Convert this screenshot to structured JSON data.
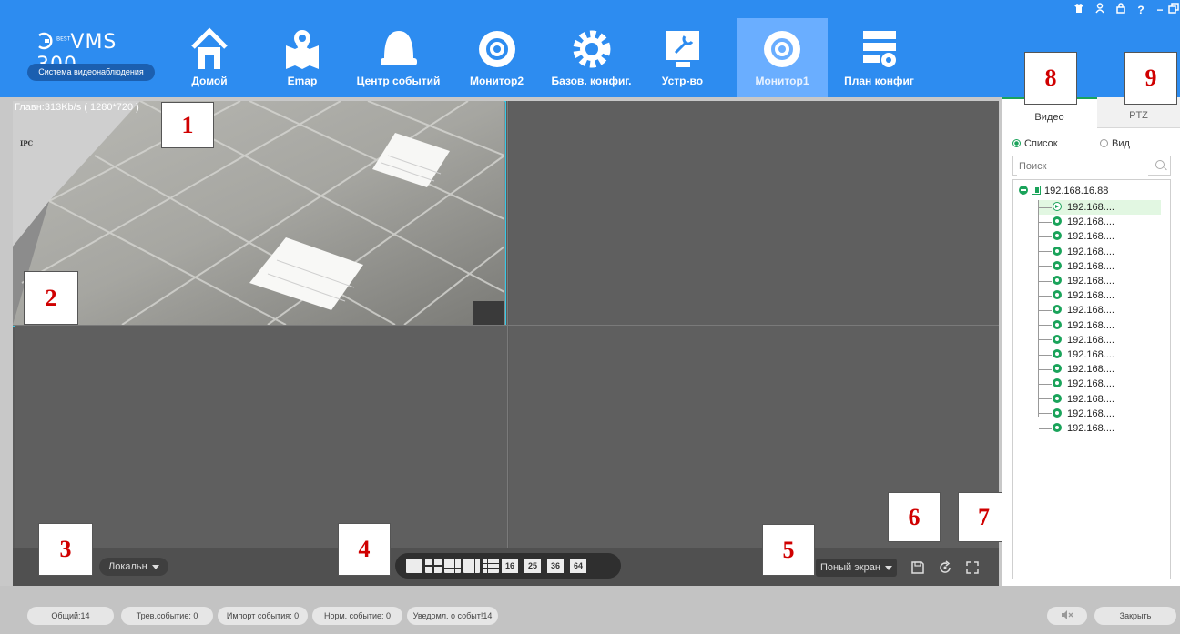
{
  "app": {
    "brand_prefix": "BEST",
    "brand_name": "VMS 300",
    "tagline": "Система видеонаблюдения"
  },
  "nav": [
    {
      "label": "Домой",
      "icon": "home-icon"
    },
    {
      "label": "Emap",
      "icon": "map-pin-icon"
    },
    {
      "label": "Центр событий",
      "icon": "alarm-bell-icon"
    },
    {
      "label": "Монитор2",
      "icon": "monitor-camera-icon"
    },
    {
      "label": "Базов. конфиг.",
      "icon": "gear-icon"
    },
    {
      "label": "Устр-во",
      "icon": "wrench-icon"
    },
    {
      "label": "Монитор1",
      "icon": "monitor-camera-icon",
      "active": true
    },
    {
      "label": "План конфиг",
      "icon": "schedule-config-icon"
    }
  ],
  "window_controls": [
    "shirt-icon",
    "user-icon",
    "lock-icon",
    "?",
    "−",
    "restore-icon",
    "×"
  ],
  "video": {
    "stream_info": "Главн:313Kb/s ( 1280*720 )",
    "camera_overlay": "IPC",
    "source_select": "Локальн",
    "layouts": [
      "1",
      "4",
      "6",
      "8",
      "9",
      "16",
      "25",
      "36",
      "64"
    ],
    "fullscreen_select": "Поный экран"
  },
  "callouts": [
    "1",
    "2",
    "3",
    "4",
    "5",
    "6",
    "7",
    "8",
    "9"
  ],
  "panel": {
    "tab_video": "Видео",
    "tab_ptz": "PTZ",
    "radio_list": "Список",
    "radio_view": "Вид",
    "search_placeholder": "Поиск",
    "root": "192.168.16.88",
    "channels": [
      "192.168....",
      "192.168....",
      "192.168....",
      "192.168....",
      "192.168....",
      "192.168....",
      "192.168....",
      "192.168....",
      "192.168....",
      "192.168....",
      "192.168....",
      "192.168....",
      "192.168....",
      "192.168....",
      "192.168....",
      "192.168...."
    ],
    "selected_index": 0
  },
  "status": {
    "total": "Общий:14",
    "alarm": "Трев.событие: 0",
    "import": "Импорт события: 0",
    "normal": "Норм. событие: 0",
    "notify": "Уведомл. о событ!14",
    "mute_icon": "speaker-mute-icon",
    "close": "Закрыть"
  },
  "colors": {
    "header": "#2d8cf0",
    "active_nav": "#6aaeff",
    "accent_green": "#1aa35a",
    "selected_pane_border": "#35c9e6",
    "callout_text": "#d00000"
  }
}
